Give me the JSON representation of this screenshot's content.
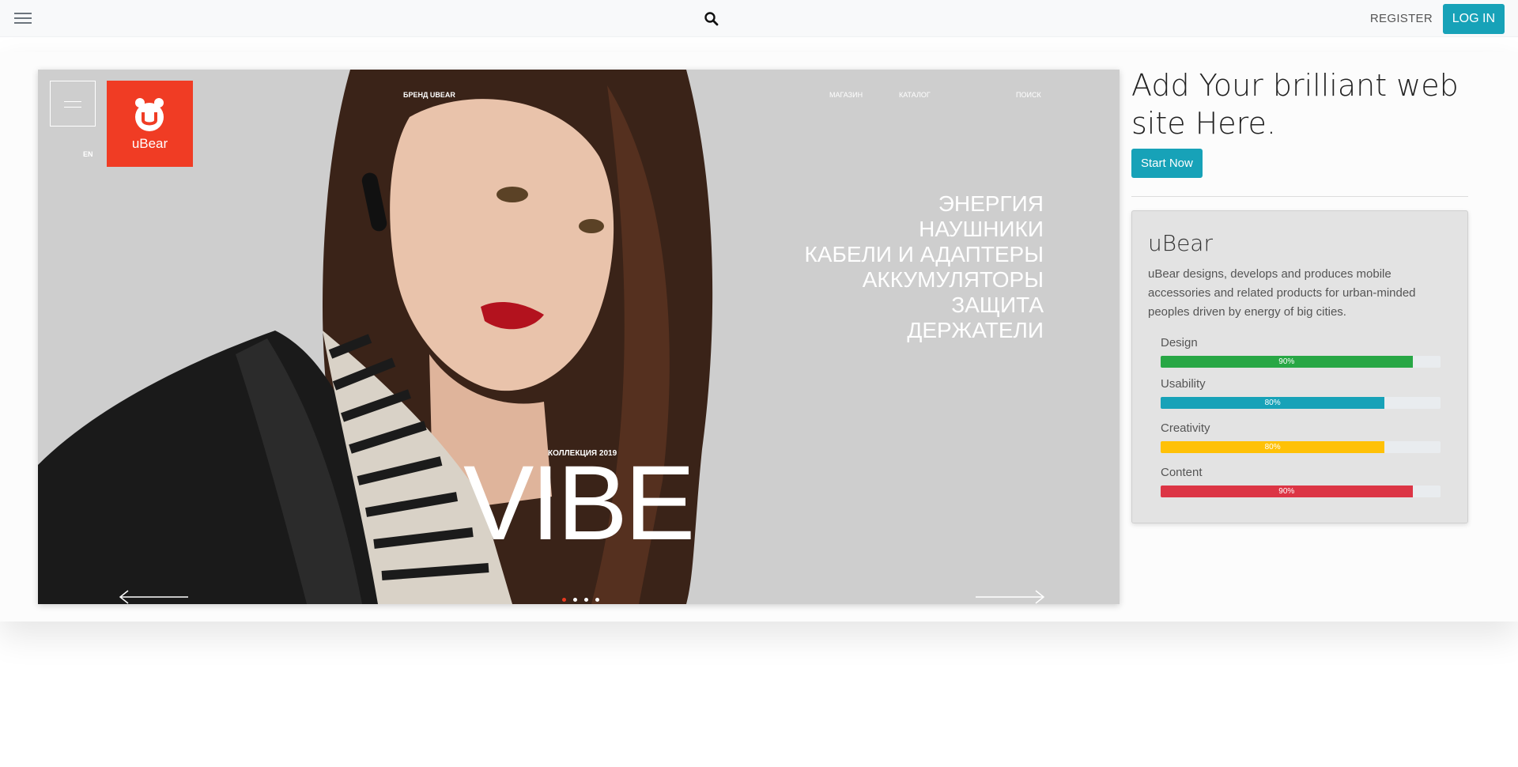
{
  "navbar": {
    "menu_icon": "hamburger-icon",
    "search_icon": "search-icon",
    "register_label": "REGISTER",
    "login_label": "LOG IN"
  },
  "hero": {
    "lang": "EN",
    "logo_text": "uBear",
    "nav": {
      "brand": "БРЕНД UBEAR",
      "shop": "МАГАЗИН",
      "catalog": "КАТАЛОГ",
      "search": "ПОИСК"
    },
    "categories": [
      "ЭНЕРГИЯ",
      "НАУШНИКИ",
      "КАБЕЛИ И АДАПТЕРЫ",
      "АККУМУЛЯТОРЫ",
      "ЗАЩИТА",
      "ДЕРЖАТЕЛИ"
    ],
    "collection": "КОЛЛЕКЦИЯ 2019",
    "headline": "VIBE",
    "slides_count": 4,
    "active_slide": 1
  },
  "promo": {
    "heading": "Add Your brilliant web site Here.",
    "cta_label": "Start Now"
  },
  "card": {
    "title": "uBear",
    "description": "uBear designs, develops and produces mobile accessories and related products for urban-minded peoples driven by energy of big cities.",
    "skills": [
      {
        "label": "Design",
        "percent": 90,
        "percent_text": "90%",
        "color": "#28a745"
      },
      {
        "label": "Usability",
        "percent": 80,
        "percent_text": "80%",
        "color": "#17a2b8"
      },
      {
        "label": "Creativity",
        "percent": 80,
        "percent_text": "80%",
        "color": "#ffc107"
      },
      {
        "label": "Content",
        "percent": 90,
        "percent_text": "90%",
        "color": "#dc3545"
      }
    ]
  },
  "colors": {
    "accent": "#17a2b8",
    "logo_red": "#f03c24"
  }
}
